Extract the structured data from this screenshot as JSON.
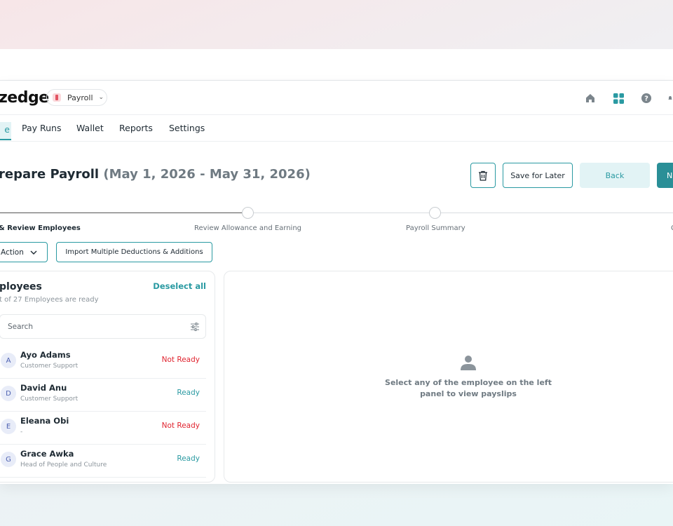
{
  "app": {
    "logo": "zedge",
    "product": "Payroll"
  },
  "header": {
    "icons": [
      "home-icon",
      "apps-grid-icon",
      "help-icon",
      "notification-bell-icon"
    ]
  },
  "nav": {
    "active_tab_partial": "e",
    "tabs": [
      "Pay Runs",
      "Wallet",
      "Reports",
      "Settings"
    ]
  },
  "page": {
    "title": "repare Payroll",
    "date_range": "(May 1, 2026 - May 31, 2026)",
    "buttons": {
      "save": "Save for Later",
      "back": "Back",
      "next_partial": "N"
    }
  },
  "stepper": {
    "steps": [
      "& Review Employees",
      "Review Allowance and Earning",
      "Payroll Summary",
      "C"
    ]
  },
  "actions": {
    "action_label": "Action",
    "import_label": "Import Multiple Deductions & Additions"
  },
  "employees_panel": {
    "title": "ployees",
    "deselect": "Deselect all",
    "subtitle": "t of 27 Employees are ready",
    "search_placeholder": "Search",
    "employees": [
      {
        "initial": "A",
        "name": "Ayo Adams",
        "role": "Customer Support",
        "status": "Not Ready"
      },
      {
        "initial": "D",
        "name": "David Anu",
        "role": "Customer Support",
        "status": "Ready"
      },
      {
        "initial": "E",
        "name": "Eleana Obi",
        "role": "-",
        "status": "Not Ready"
      },
      {
        "initial": "G",
        "name": "Grace Awka",
        "role": "Head of People and Culture",
        "status": "Ready"
      }
    ]
  },
  "payslip_panel": {
    "empty_message": "Select any of the employee on the left panel to view payslips"
  },
  "colors": {
    "accent": "#2a9aa2",
    "not_ready": "#e0242f",
    "ready": "#2a9aa2"
  }
}
